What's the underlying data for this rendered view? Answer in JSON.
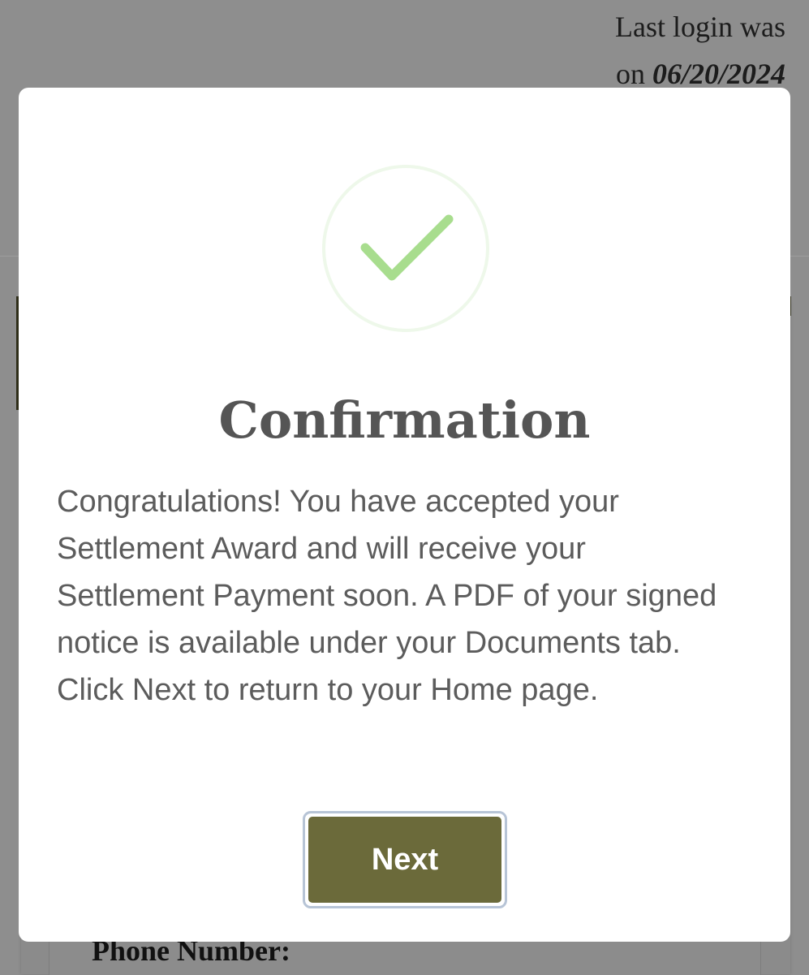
{
  "header": {
    "last_login_prefix_line1": "Last login was",
    "last_login_prefix_line2": "on",
    "last_login_date": "06/20/2024"
  },
  "background_form": {
    "phone_label": "Phone Number:"
  },
  "modal": {
    "icon": "checkmark-icon",
    "title": "Confirmation",
    "body": "Congratulations! You have accepted your Settlement Award and will receive your Settlement Payment soon. A PDF of your signed notice is available under your Documents tab. Click Next to return to your Home page.",
    "next_label": "Next"
  },
  "colors": {
    "checkmark": "#a8dd8e",
    "check_ring": "#eef8ea",
    "button_bg": "#6b6a3a",
    "button_focus_ring": "#b7c4d6",
    "title_text": "#555555",
    "overlay": "#8e8e8e"
  }
}
